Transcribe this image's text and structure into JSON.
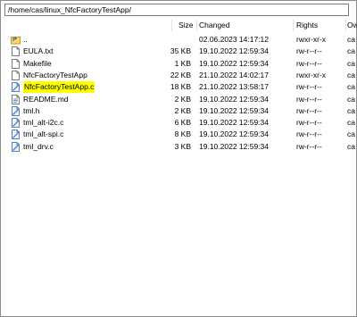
{
  "path": "/home/cas/linux_NfcFactoryTestApp/",
  "columns": {
    "size": "Size",
    "changed": "Changed",
    "rights": "Rights",
    "owner": "Ow"
  },
  "rows": [
    {
      "name": "..",
      "size": "",
      "changed": "02.06.2023 14:17:12",
      "rights": "rwxr-xr-x",
      "owner": "ca",
      "icon": "parent-folder-icon"
    },
    {
      "name": "EULA.txt",
      "size": "35 KB",
      "changed": "19.10.2022 12:59:34",
      "rights": "rw-r--r--",
      "owner": "ca",
      "icon": "file-icon"
    },
    {
      "name": "Makefile",
      "size": "1 KB",
      "changed": "19.10.2022 12:59:34",
      "rights": "rw-r--r--",
      "owner": "ca",
      "icon": "file-icon"
    },
    {
      "name": "NfcFactoryTestApp",
      "size": "22 KB",
      "changed": "21.10.2022 14:02:17",
      "rights": "rwxr-xr-x",
      "owner": "ca",
      "icon": "file-icon"
    },
    {
      "name": "NfcFactoryTestApp.c",
      "size": "18 KB",
      "changed": "21.10.2022 13:58:17",
      "rights": "rw-r--r--",
      "owner": "ca",
      "icon": "c-file-icon",
      "highlight": true
    },
    {
      "name": "README.md",
      "size": "2 KB",
      "changed": "19.10.2022 12:59:34",
      "rights": "rw-r--r--",
      "owner": "ca",
      "icon": "text-file-icon"
    },
    {
      "name": "tml.h",
      "size": "2 KB",
      "changed": "19.10.2022 12:59:34",
      "rights": "rw-r--r--",
      "owner": "ca",
      "icon": "c-file-icon"
    },
    {
      "name": "tml_alt-i2c.c",
      "size": "6 KB",
      "changed": "19.10.2022 12:59:34",
      "rights": "rw-r--r--",
      "owner": "ca",
      "icon": "c-file-icon"
    },
    {
      "name": "tml_alt-spi.c",
      "size": "8 KB",
      "changed": "19.10.2022 12:59:34",
      "rights": "rw-r--r--",
      "owner": "ca",
      "icon": "c-file-icon"
    },
    {
      "name": "tml_drv.c",
      "size": "3 KB",
      "changed": "19.10.2022 12:59:34",
      "rights": "rw-r--r--",
      "owner": "ca",
      "icon": "c-file-icon"
    }
  ],
  "colors": {
    "highlight": "#ffff00",
    "border": "#8c8c8c"
  }
}
